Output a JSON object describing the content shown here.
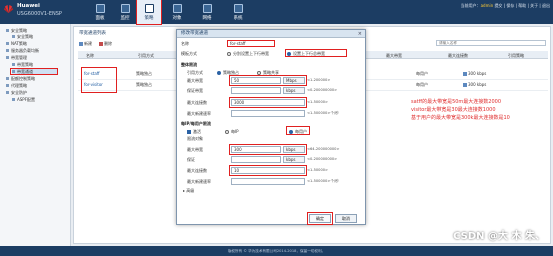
{
  "header": {
    "brand": "Huawei",
    "model": "USG6000V1-ENSP",
    "nav": [
      {
        "label": "面板",
        "icon": "dashboard-icon"
      },
      {
        "label": "监控",
        "icon": "monitor-icon"
      },
      {
        "label": "策略",
        "icon": "policy-icon"
      },
      {
        "label": "对象",
        "icon": "object-icon"
      },
      {
        "label": "网络",
        "icon": "network-icon"
      },
      {
        "label": "系统",
        "icon": "system-icon"
      }
    ],
    "user_prefix": "当前用户：",
    "user": "admin",
    "user_links": "提交 | 保存 | 帮助 | 关于 | 退出"
  },
  "sidebar": {
    "items": [
      {
        "label": "安全策略"
      },
      {
        "label": "安全策略"
      },
      {
        "label": "NAT策略"
      },
      {
        "label": "服务器负载均衡"
      },
      {
        "label": "带宽管理"
      },
      {
        "label": "带宽策略"
      },
      {
        "label": "带宽通道"
      },
      {
        "label": "配额控制策略"
      },
      {
        "label": "代理策略"
      },
      {
        "label": "安全防护"
      },
      {
        "label": "ASPF配置"
      }
    ]
  },
  "panel": {
    "title": "带宽通道列表",
    "toolbar": {
      "add": "新建",
      "delete": "删除"
    },
    "search_field": "名称",
    "search_placeholder": "请输入名称",
    "columns": [
      "名称",
      "引用方式",
      "最大带宽",
      "最大连接数",
      "引用策略"
    ],
    "rows": [
      {
        "name": "for-staff",
        "mode": "策略独占",
        "ref": "300 kbps",
        "mode2": "每用户"
      },
      {
        "name": "for-visitor",
        "mode": "策略独占",
        "ref": "300 kbps",
        "mode2": "每用户"
      }
    ]
  },
  "dialog": {
    "title": "修改带宽通道",
    "close": "×",
    "name_label": "名称",
    "name_value": "for-staff",
    "desc_label": "描述",
    "mode_label": "模板方式",
    "mode_options": [
      "分别设置上下行带宽",
      "设置上下行总带宽"
    ],
    "overall_section": "整体限流",
    "ref_label": "引用方式",
    "ref_options": [
      "策略独占",
      "策略共享"
    ],
    "max_bw_label": "最大带宽",
    "max_bw_value": "50",
    "max_bw_unit": "Mbps",
    "max_bw_hint": "<1-200000>",
    "guarantee_label": "保证带宽",
    "guarantee_unit": "kbps",
    "guarantee_hint": "<0-200000000>",
    "max_conn_label": "最大连接数",
    "max_conn_value": "3000",
    "max_conn_hint": "<1-50000>",
    "new_conn_label": "最大新建速率",
    "new_conn_hint": "<1-500000>个/秒",
    "per_ip_section": "每IP/每用户限流",
    "per_ip_enable": "激活",
    "per_ip_options": [
      "每IP",
      "每用户"
    ],
    "per_ip_mode_label": "限流对象",
    "per_ip_bw_label": "最大带宽",
    "per_ip_bw_value": "300",
    "per_ip_bw_unit": "kbps",
    "per_ip_bw_hint": "<64-200000000>",
    "per_ip_guarantee_label": "保证",
    "per_ip_guarantee_unit": "kbps",
    "per_ip_guarantee_hint": "<0-200000000>",
    "per_ip_conn_label": "最大连接数",
    "per_ip_conn_value": "10",
    "per_ip_conn_hint": "<1-50000>",
    "per_ip_new_label": "最大新建速率",
    "per_ip_new_hint": "<1-500000>个/秒",
    "advanced": "高级",
    "ok": "确定",
    "cancel": "取消"
  },
  "annotation": {
    "lines": [
      "satff的最大带宽是50m最大连接数2000",
      "visitor最大带宽是30最大连接数1000",
      "基于用户的最大带宽是300k最大连接数是10"
    ]
  },
  "footer": {
    "text": "版权所有 © 华为技术有限公司2014-2018，保留一切权利。"
  },
  "watermark": "CSDN @大 木 朱、"
}
